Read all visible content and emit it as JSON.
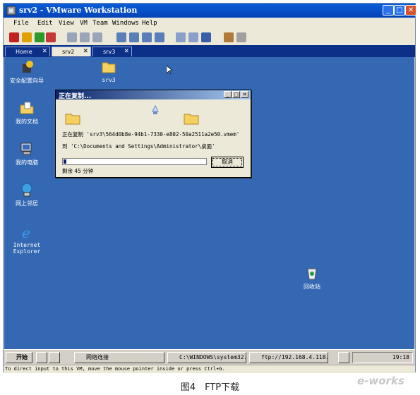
{
  "window": {
    "title": "srv2 - VMware Workstation"
  },
  "menu": [
    "File",
    "Edit",
    "View",
    "VM",
    "Team",
    "Windows",
    "Help"
  ],
  "tabs": [
    {
      "label": "Home"
    },
    {
      "label": "srv2"
    },
    {
      "label": "srv3"
    }
  ],
  "desktop_icons": [
    {
      "label": "安全配置向导",
      "icon": "security-wizard-icon"
    },
    {
      "label": "srv3",
      "icon": "folder-icon"
    },
    {
      "label": "我的文档",
      "icon": "my-documents-icon"
    },
    {
      "label": "我的电脑",
      "icon": "my-computer-icon"
    },
    {
      "label": "网上邻居",
      "icon": "network-places-icon"
    },
    {
      "label": "Internet Explorer",
      "icon": "internet-explorer-icon"
    },
    {
      "label": "回收站",
      "icon": "recycle-bin-icon"
    }
  ],
  "copy_dialog": {
    "title": "正在复制...",
    "line1": "正在复制 'srv3\\564d0b8e-94b1-7330-e802-50a2511a2e50.vmem'",
    "line2": "到 'C:\\Documents and Settings\\Administrator\\桌面'",
    "remaining": "剩余 45 分钟",
    "cancel_label": "取消",
    "progress": 0.02
  },
  "taskbar": {
    "start_label": "开始",
    "buttons": [
      "网络连接",
      "C:\\WINDOWS\\system32...",
      "ftp://192.168.4.118..."
    ],
    "clock": "19:18"
  },
  "statusbar": {
    "text": "To direct input to this VM, move the mouse pointer inside or press Ctrl+G."
  },
  "caption": "图4　FTP下载",
  "watermark": "e-works",
  "colors": {
    "desktop": "#3468b3",
    "titlebar": "#0a5ed7",
    "dialog_title": "#0a246a"
  }
}
